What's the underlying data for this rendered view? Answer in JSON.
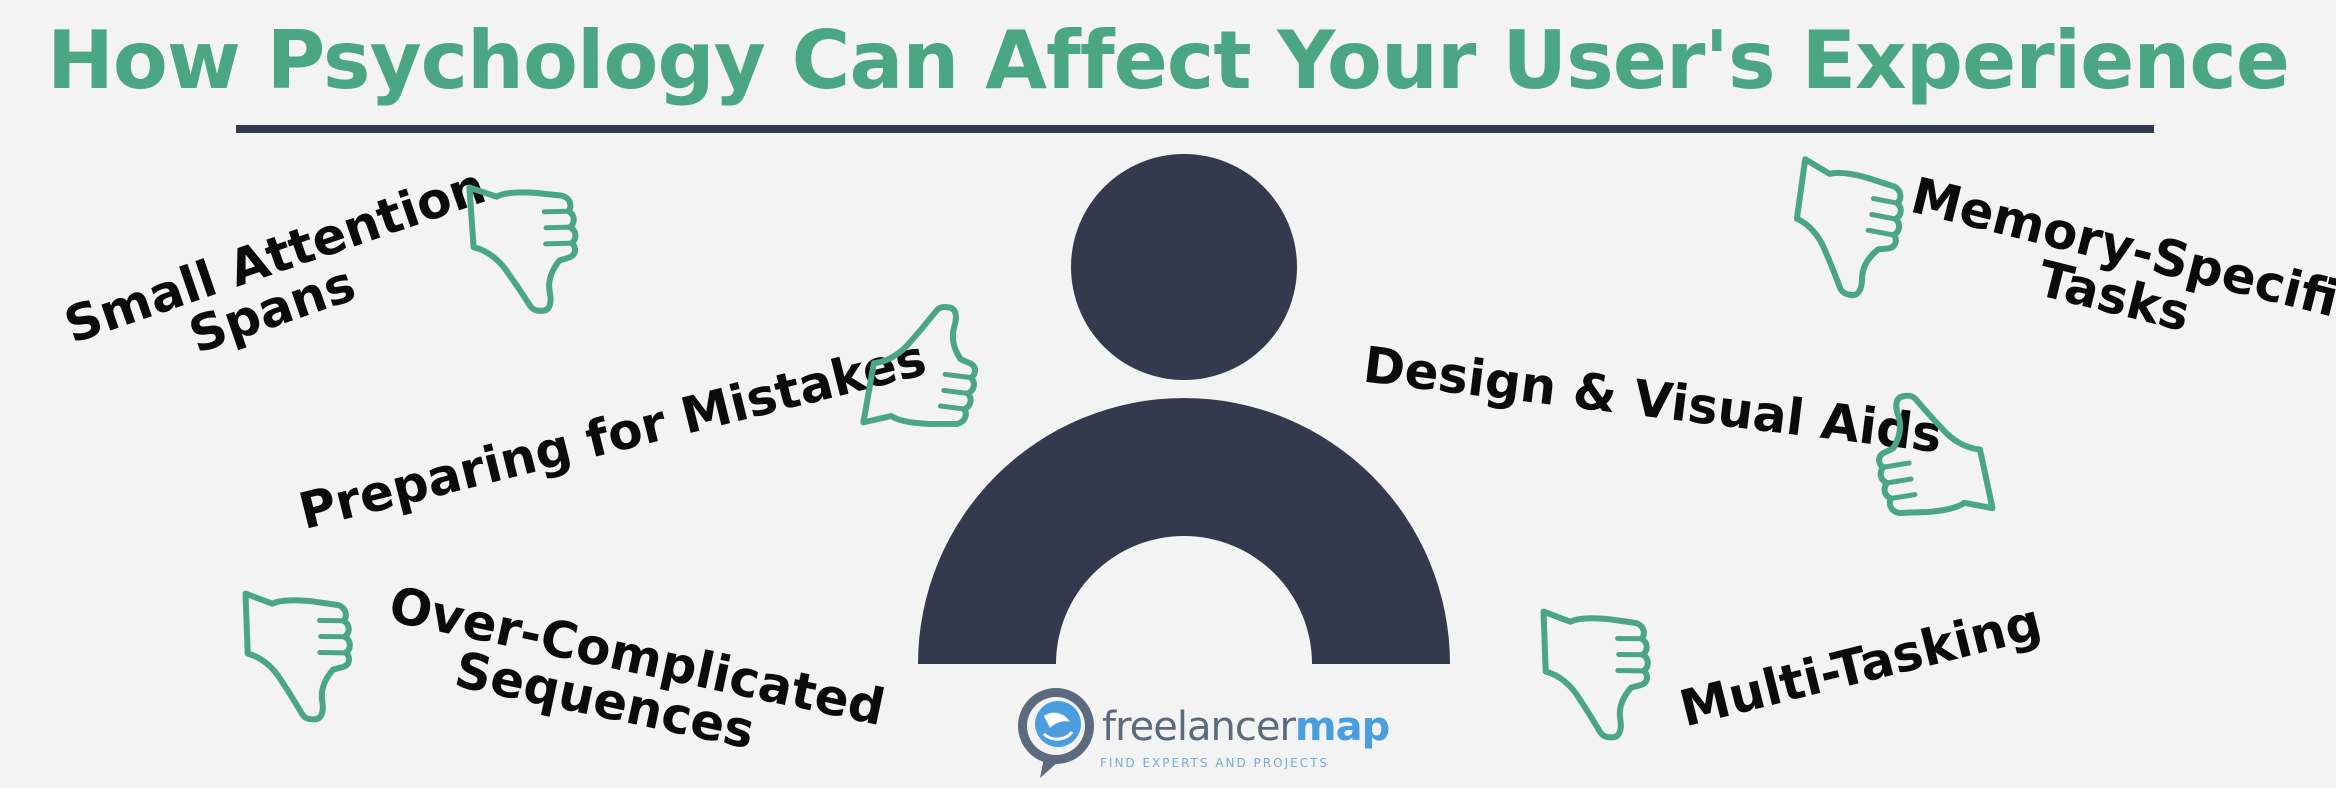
{
  "title": "How Psychology Can Affect Your User's Experience",
  "colors": {
    "accent": "#4aa684",
    "figure": "#343a4e",
    "background": "#f3f3f3",
    "text": "#0b0b0b"
  },
  "items": [
    {
      "id": "small-attention-spans",
      "lines": [
        "Small Attention",
        "Spans"
      ],
      "icon": "thumbs-down-icon"
    },
    {
      "id": "preparing-for-mistakes",
      "lines": [
        "Preparing for Mistakes"
      ],
      "icon": "thumbs-up-icon"
    },
    {
      "id": "over-complicated-sequences",
      "lines": [
        "Over-Complicated",
        "Sequences"
      ],
      "icon": "thumbs-down-icon"
    },
    {
      "id": "memory-specific-tasks",
      "lines": [
        "Memory-Specific",
        "Tasks"
      ],
      "icon": "thumbs-down-icon"
    },
    {
      "id": "design-visual-aids",
      "lines": [
        "Design & Visual Aids"
      ],
      "icon": "thumbs-up-icon"
    },
    {
      "id": "multi-tasking",
      "lines": [
        "Multi-Tasking"
      ],
      "icon": "thumbs-down-icon"
    }
  ],
  "logo": {
    "word_1": "freelancer",
    "word_2": "map",
    "tagline": "FIND EXPERTS AND PROJECTS"
  }
}
